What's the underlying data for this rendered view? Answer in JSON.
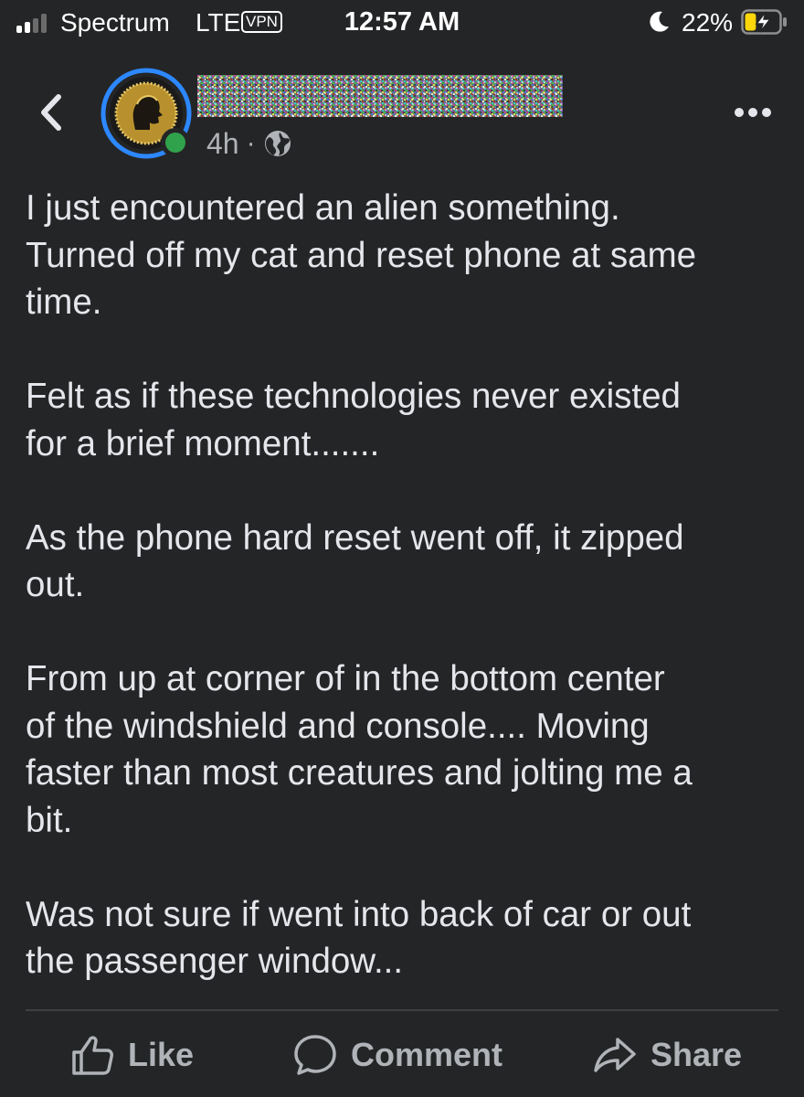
{
  "status_bar": {
    "carrier": "Spectrum",
    "network": "LTE",
    "vpn": "VPN",
    "time": "12:57 AM",
    "battery": "22%",
    "signal_bars_active": 2,
    "signal_bars_total": 4,
    "battery_level": 0.22,
    "charging": true,
    "colors": {
      "battery_fill": "#ffd60a",
      "text": "#ffffff"
    }
  },
  "post": {
    "author_name_redacted": true,
    "time": "4h",
    "separator": "·",
    "privacy_icon": "globe-icon",
    "author_online": true,
    "paragraphs": [
      "I just encountered an alien something.\nTurned off my cat and reset phone at same\ntime.",
      "Felt as if these technologies never existed\nfor a brief moment.......",
      "As the phone hard reset went off, it zipped\nout.",
      "From up at corner of in the bottom center\nof the windshield and console....  Moving\nfaster than most creatures and jolting me a\nbit.",
      "Was not sure if went into back of car or out\nthe passenger window..."
    ]
  },
  "actions": {
    "like": "Like",
    "comment": "Comment",
    "share": "Share"
  },
  "theme": {
    "background": "#242526",
    "text": "#e4e6eb",
    "secondary": "#b0b3b8",
    "online": "#31a24c"
  }
}
